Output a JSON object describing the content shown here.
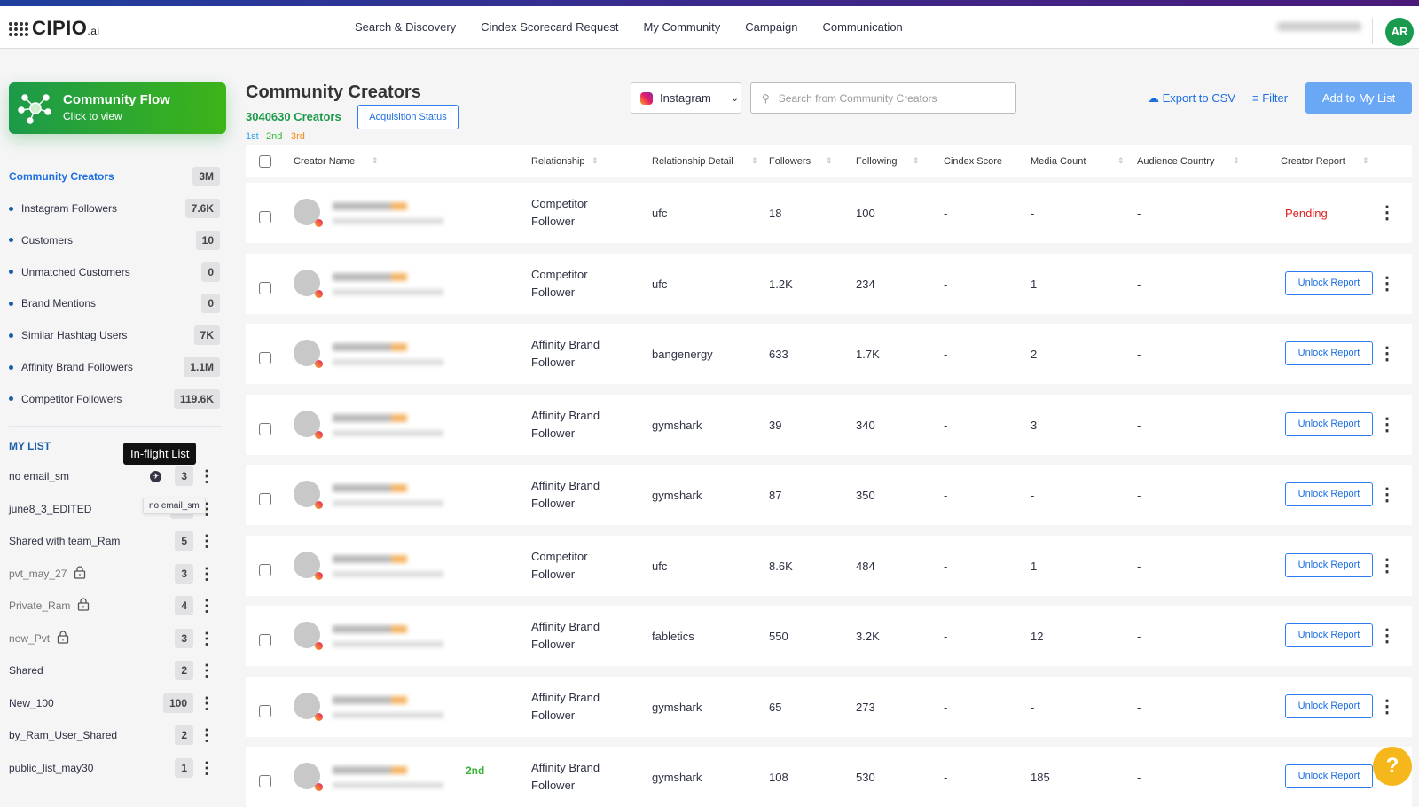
{
  "app": {
    "logo": "CIPIO",
    "logo_suffix": ".ai",
    "user_initials": "AR"
  },
  "nav": [
    "Search & Discovery",
    "Cindex Scorecard Request",
    "My Community",
    "Campaign",
    "Communication"
  ],
  "flow": {
    "title": "Community Flow",
    "subtitle": "Click to view"
  },
  "sidebar": {
    "main": {
      "label": "Community Creators",
      "count": "3M"
    },
    "items": [
      {
        "label": "Instagram Followers",
        "count": "7.6K"
      },
      {
        "label": "Customers",
        "count": "10"
      },
      {
        "label": "Unmatched Customers",
        "count": "0"
      },
      {
        "label": "Brand Mentions",
        "count": "0"
      },
      {
        "label": "Similar Hashtag Users",
        "count": "7K"
      },
      {
        "label": "Affinity Brand Followers",
        "count": "1.1M"
      },
      {
        "label": "Competitor Followers",
        "count": "119.6K"
      }
    ],
    "mylist_title": "MY LIST",
    "tooltip": "In-flight List",
    "tooltip2": "no email_sm",
    "lists": [
      {
        "label": "no email_sm",
        "count": "3",
        "icon": "plane"
      },
      {
        "label": "june8_3_EDITED",
        "count": ""
      },
      {
        "label": "Shared with team_Ram",
        "count": "5"
      },
      {
        "label": "pvt_may_27",
        "count": "3",
        "icon": "lock"
      },
      {
        "label": "Private_Ram",
        "count": "4",
        "icon": "lock"
      },
      {
        "label": "new_Pvt",
        "count": "3",
        "icon": "lock"
      },
      {
        "label": "Shared",
        "count": "2"
      },
      {
        "label": "New_100",
        "count": "100"
      },
      {
        "label": "by_Ram_User_Shared",
        "count": "2"
      },
      {
        "label": "public_list_may30",
        "count": "1"
      }
    ]
  },
  "main": {
    "title": "Community Creators",
    "count": "3040630 Creators",
    "acquisition": "Acquisition Status",
    "degrees": [
      "1st",
      "2nd",
      "3rd"
    ],
    "platform": "Instagram",
    "search_placeholder": "Search from Community Creators",
    "export": "Export to CSV",
    "filter": "Filter",
    "add": "Add to My List"
  },
  "columns": [
    "Creator Name",
    "Relationship",
    "Relationship Detail",
    "Followers",
    "Following",
    "Cindex Score",
    "Media Count",
    "Audience Country",
    "Creator Report"
  ],
  "rows": [
    {
      "rel1": "Competitor",
      "rel2": "Follower",
      "detail": "ufc",
      "followers": "18",
      "following": "100",
      "cindex": "-",
      "media": "-",
      "country": "-",
      "report": "Pending"
    },
    {
      "rel1": "Competitor",
      "rel2": "Follower",
      "detail": "ufc",
      "followers": "1.2K",
      "following": "234",
      "cindex": "-",
      "media": "1",
      "country": "-",
      "report": "Unlock Report"
    },
    {
      "rel1": "Affinity Brand",
      "rel2": "Follower",
      "detail": "bangenergy",
      "followers": "633",
      "following": "1.7K",
      "cindex": "-",
      "media": "2",
      "country": "-",
      "report": "Unlock Report"
    },
    {
      "rel1": "Affinity Brand",
      "rel2": "Follower",
      "detail": "gymshark",
      "followers": "39",
      "following": "340",
      "cindex": "-",
      "media": "3",
      "country": "-",
      "report": "Unlock Report"
    },
    {
      "rel1": "Affinity Brand",
      "rel2": "Follower",
      "detail": "gymshark",
      "followers": "87",
      "following": "350",
      "cindex": "-",
      "media": "-",
      "country": "-",
      "report": "Unlock Report"
    },
    {
      "rel1": "Competitor",
      "rel2": "Follower",
      "detail": "ufc",
      "followers": "8.6K",
      "following": "484",
      "cindex": "-",
      "media": "1",
      "country": "-",
      "report": "Unlock Report"
    },
    {
      "rel1": "Affinity Brand",
      "rel2": "Follower",
      "detail": "fabletics",
      "followers": "550",
      "following": "3.2K",
      "cindex": "-",
      "media": "12",
      "country": "-",
      "report": "Unlock Report"
    },
    {
      "rel1": "Affinity Brand",
      "rel2": "Follower",
      "detail": "gymshark",
      "followers": "65",
      "following": "273",
      "cindex": "-",
      "media": "-",
      "country": "-",
      "report": "Unlock Report"
    },
    {
      "rel1": "Affinity Brand",
      "rel2": "Follower",
      "detail": "gymshark",
      "followers": "108",
      "following": "530",
      "cindex": "-",
      "media": "185",
      "country": "-",
      "report": "Unlock Report",
      "degree": "2nd"
    }
  ],
  "colors": {
    "accent": "#1d6fe0",
    "green": "#1e9a4c",
    "pending": "#e02020",
    "help": "#f5b71b"
  }
}
